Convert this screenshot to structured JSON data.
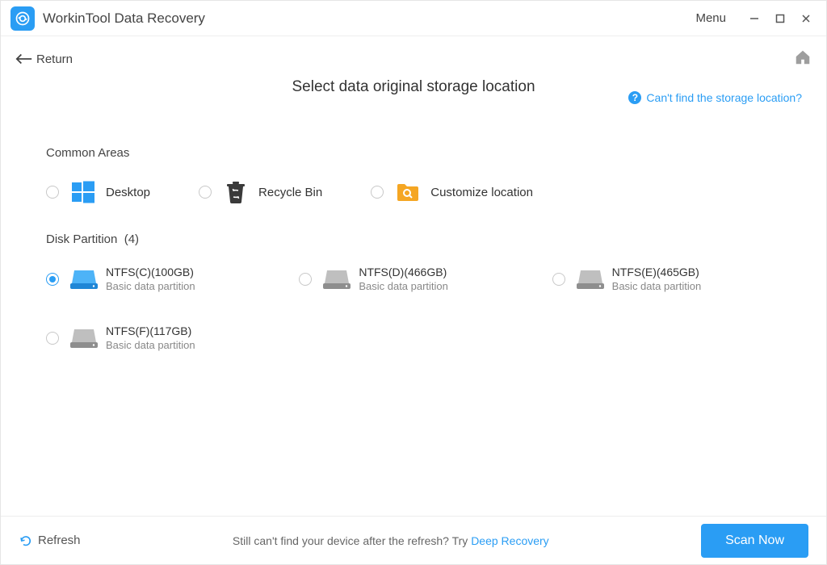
{
  "titlebar": {
    "app_name": "WorkinTool Data Recovery",
    "menu": "Menu"
  },
  "nav": {
    "return": "Return"
  },
  "main": {
    "heading": "Select data original storage location",
    "help_link": "Can't find the storage location?",
    "section_common": "Common Areas",
    "options": [
      {
        "label": "Desktop"
      },
      {
        "label": "Recycle Bin"
      },
      {
        "label": "Customize location"
      }
    ],
    "section_disk_label": "Disk Partition",
    "section_disk_count": "(4)",
    "partitions": [
      {
        "name": "NTFS(C)(100GB)",
        "desc": "Basic data partition",
        "selected": true
      },
      {
        "name": "NTFS(D)(466GB)",
        "desc": "Basic data partition",
        "selected": false
      },
      {
        "name": "NTFS(E)(465GB)",
        "desc": "Basic data partition",
        "selected": false
      },
      {
        "name": "NTFS(F)(117GB)",
        "desc": "Basic data partition",
        "selected": false
      }
    ]
  },
  "footer": {
    "refresh": "Refresh",
    "hint_prefix": "Still can't find your device after the refresh? Try ",
    "hint_link": "Deep Recovery",
    "scan": "Scan Now"
  }
}
